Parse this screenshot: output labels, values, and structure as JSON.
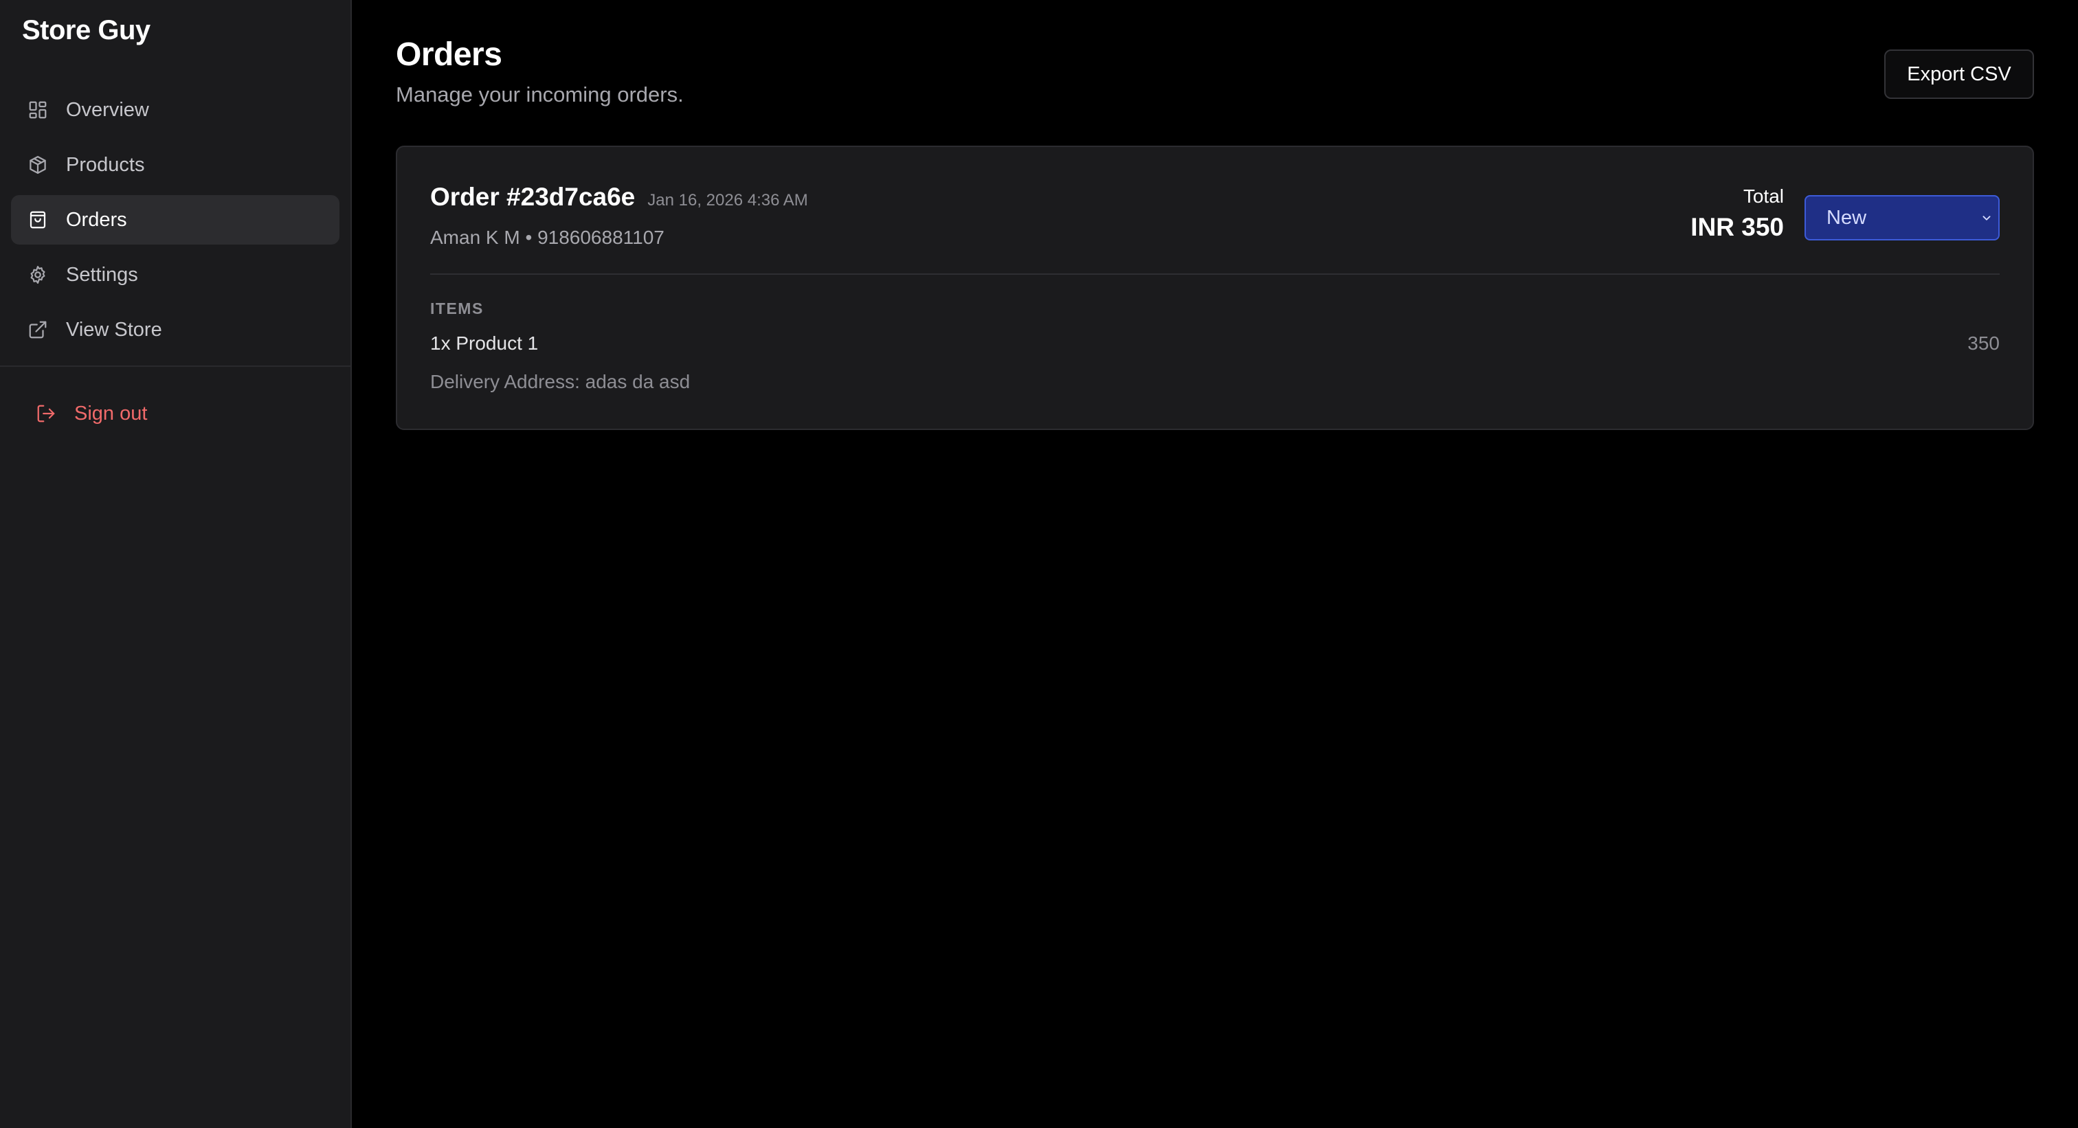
{
  "app": {
    "brand": "Store Guy"
  },
  "sidebar": {
    "items": [
      {
        "label": "Overview",
        "icon": "grid-icon"
      },
      {
        "label": "Products",
        "icon": "package-icon"
      },
      {
        "label": "Orders",
        "icon": "shopping-bag-icon",
        "active": true
      },
      {
        "label": "Settings",
        "icon": "gear-icon"
      },
      {
        "label": "View Store",
        "icon": "external-link-icon"
      }
    ],
    "signout_label": "Sign out",
    "signout_icon": "logout-icon"
  },
  "header": {
    "title": "Orders",
    "subtitle": "Manage your incoming orders.",
    "export_label": "Export CSV"
  },
  "orders": [
    {
      "title": "Order #23d7ca6e",
      "date": "Jan 16, 2026 4:36 AM",
      "customer": "Aman K M • 918606881107",
      "total_label": "Total",
      "total_value": "INR 350",
      "status": "New",
      "items_label": "ITEMS",
      "items": [
        {
          "name": "1x Product 1",
          "price": "350"
        }
      ],
      "address": "Delivery Address: adas da asd"
    }
  ],
  "colors": {
    "background": "#000000",
    "sidebar": "#1b1b1d",
    "card": "#1b1b1d",
    "accent_status": "#1f2f86",
    "signout": "#f06a6a"
  }
}
